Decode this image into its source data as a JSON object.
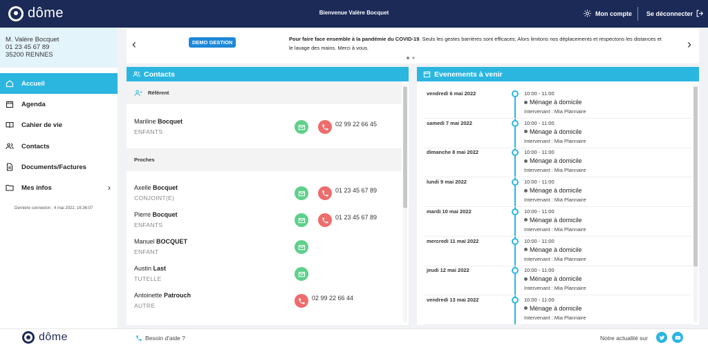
{
  "app": {
    "brand": "dôme"
  },
  "header": {
    "welcome": "Bienvenue Valère Bocquet",
    "account_label": "Mon compte",
    "logout_label": "Se déconnecter"
  },
  "user": {
    "name": "M. Valère Bocquet",
    "phone": "01 23 45 67 89",
    "city": "35200 RENNES"
  },
  "nav": {
    "items": [
      {
        "label": "Accueil",
        "icon": "home-icon",
        "active": true
      },
      {
        "label": "Agenda",
        "icon": "calendar-icon"
      },
      {
        "label": "Cahier de vie",
        "icon": "book-icon"
      },
      {
        "label": "Contacts",
        "icon": "contacts-icon"
      },
      {
        "label": "Documents/Factures",
        "icon": "document-icon"
      },
      {
        "label": "Mes infos",
        "icon": "folder-icon"
      }
    ],
    "last_login": "Dernière connexion : 4 mai 2022, 16:36:07"
  },
  "banner": {
    "badge": "DEMO GESTION",
    "text_bold": "Pour faire face ensemble à la pandémie du COVID-19",
    "text_rest": ". Seuls les gestes barrières sont efficaces; Alors limitons nos déplacements et respectons les distances et le lavage des mains. Merci à vous."
  },
  "contacts": {
    "title": "Contacts",
    "referent_label": "Référent",
    "proches_label": "Proches",
    "referent": {
      "first": "Mariline",
      "last": "Bocquet",
      "role": "ENFANTS",
      "phone": "02 99 22 66 45",
      "has_mail": true,
      "has_call": true
    },
    "proches": [
      {
        "first": "Axelle",
        "last": "Bocquet",
        "role": "CONJOINT(E)",
        "phone": "01 23 45 67 89",
        "has_mail": true,
        "has_call": true
      },
      {
        "first": "Pierre",
        "last": "Bocquet",
        "role": "ENFANTS",
        "phone": "01 23 45 67 89",
        "has_mail": true,
        "has_call": true
      },
      {
        "first": "Manuel",
        "last": "BOCQUET",
        "role": "ENFANT",
        "phone": "",
        "has_mail": true,
        "has_call": false
      },
      {
        "first": "Austin",
        "last": "Last",
        "role": "TUTELLE",
        "phone": "",
        "has_mail": true,
        "has_call": false
      },
      {
        "first": "Antoinette",
        "last": "Patrouch",
        "role": "AUTRE",
        "phone": "02 99 22 66 44",
        "has_mail": false,
        "has_call": true
      }
    ]
  },
  "events": {
    "title": "Evenements à venir",
    "items": [
      {
        "date": "vendredi 6 mai 2022",
        "time": "10:00 - 11:00",
        "title": "Ménage à domicile",
        "intervenant": "Intervenant : Mia Plannaire"
      },
      {
        "date": "samedi 7 mai 2022",
        "time": "10:00 - 11:00",
        "title": "Ménage à domicile",
        "intervenant": "Intervenant : Mia Plannaire"
      },
      {
        "date": "dimanche 8 mai 2022",
        "time": "10:00 - 11:00",
        "title": "Ménage à domicile",
        "intervenant": "Intervenant : Mia Plannaire"
      },
      {
        "date": "lundi 9 mai 2022",
        "time": "10:00 - 11:00",
        "title": "Ménage à domicile",
        "intervenant": "Intervenant : Mia Plannaire"
      },
      {
        "date": "mardi 10 mai 2022",
        "time": "10:00 - 11:00",
        "title": "Ménage à domicile",
        "intervenant": "Intervenant : Mia Plannaire"
      },
      {
        "date": "mercredi 11 mai 2022",
        "time": "10:00 - 11:00",
        "title": "Ménage à domicile",
        "intervenant": "Intervenant : Mia Plannaire"
      },
      {
        "date": "jeudi 12 mai 2022",
        "time": "10:00 - 11:00",
        "title": "Ménage à domicile",
        "intervenant": "Intervenant : Mia Plannaire"
      },
      {
        "date": "vendredi 13 mai 2022",
        "time": "10:00 - 11:00",
        "title": "Ménage à domicile",
        "intervenant": "Intervenant : Mia Plannaire"
      }
    ]
  },
  "footer": {
    "help": "Besoin d'aide ?",
    "news": "Notre actualité sur",
    "social": [
      "twitter-icon",
      "youtube-icon"
    ]
  },
  "colors": {
    "navy": "#1b2a56",
    "accent": "#2bb6e0",
    "mail": "#5fd08b",
    "call": "#ef6c6c"
  }
}
